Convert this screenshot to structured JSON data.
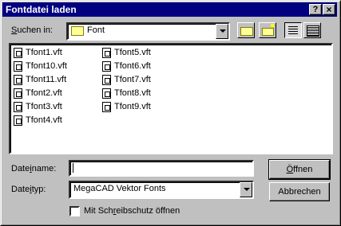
{
  "window": {
    "title": "Fontdatei laden"
  },
  "titlebar_buttons": {
    "help": "?",
    "close": "×"
  },
  "lookin": {
    "label_pre": "",
    "label_access": "S",
    "label_post": "uchen in:",
    "value": "Font"
  },
  "files": [
    "Tfont1.vft",
    "Tfont10.vft",
    "Tfont11.vft",
    "Tfont2.vft",
    "Tfont3.vft",
    "Tfont4.vft",
    "Tfont5.vft",
    "Tfont6.vft",
    "Tfont7.vft",
    "Tfont8.vft",
    "Tfont9.vft"
  ],
  "filename": {
    "label_pre": "Date",
    "label_access": "i",
    "label_post": "name:",
    "value": ""
  },
  "filetype": {
    "label_pre": "Date",
    "label_access": "i",
    "label_post": "typ:",
    "value": "MegaCAD Vektor Fonts"
  },
  "buttons": {
    "open_pre": "",
    "open_access": "Ö",
    "open_post": "ffnen",
    "cancel": "Abbrechen"
  },
  "readonly": {
    "label_pre": "Mit Sch",
    "label_access": "r",
    "label_post": "eibschutz öffnen",
    "checked": false
  },
  "icons": {
    "folder": "folder-icon",
    "up": "up-folder-icon",
    "new": "new-folder-icon",
    "list": "list-view-icon",
    "details": "details-view-icon"
  }
}
